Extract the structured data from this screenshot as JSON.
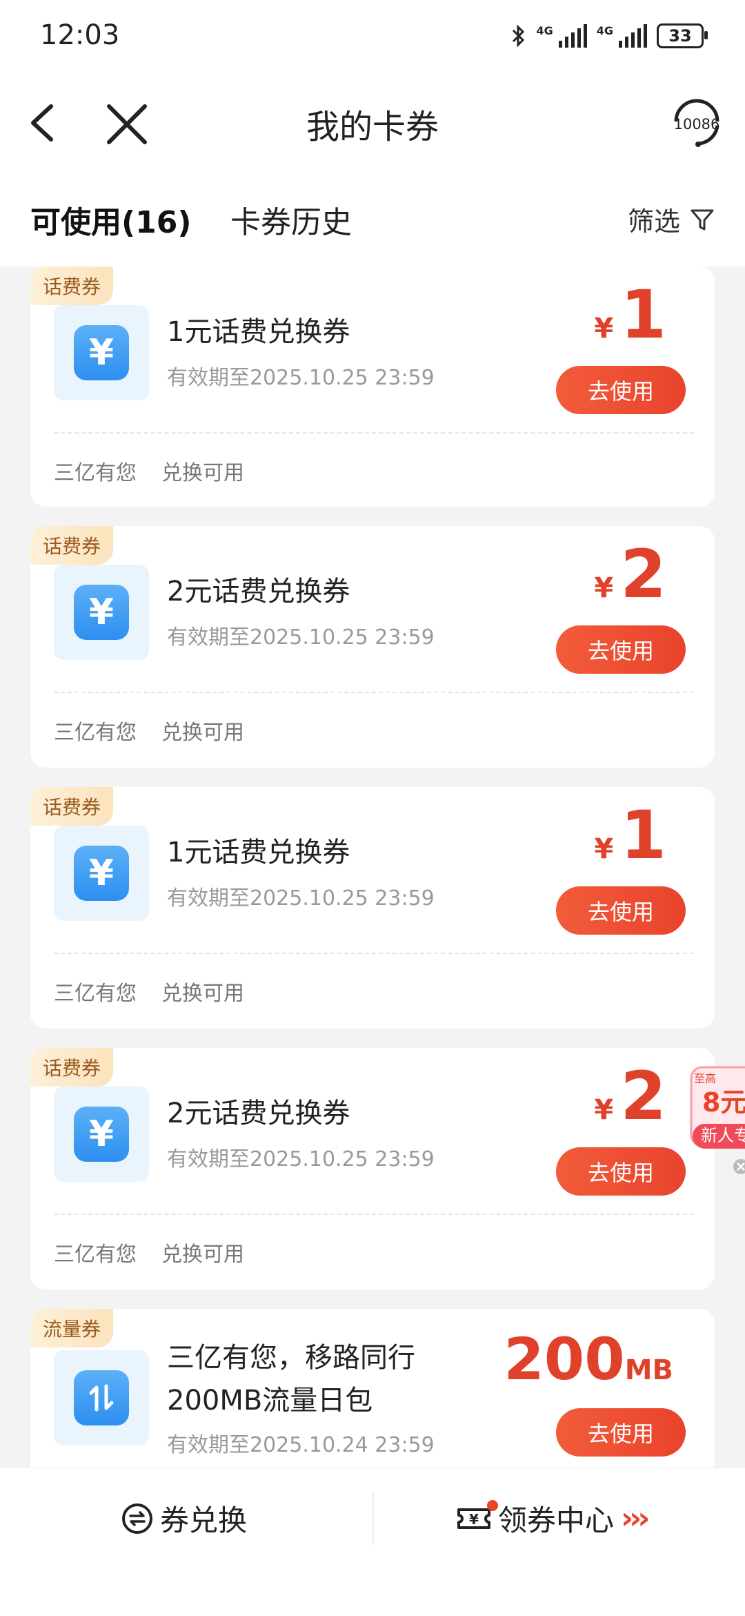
{
  "status_bar": {
    "time": "12:03",
    "network_1": "4G",
    "network_2": "4G",
    "battery": "33"
  },
  "nav": {
    "title": "我的卡券",
    "service_number": "10086"
  },
  "tabs": {
    "available": "可使用(16)",
    "history": "卡券历史",
    "filter": "筛选"
  },
  "coupons": [
    {
      "tag": "话费券",
      "icon": "yuan-icon",
      "title": "1元话费兑换券",
      "validity": "有效期至2025.10.25 23:59",
      "currency": "¥",
      "amount": "1",
      "button": "去使用",
      "source": "三亿有您",
      "note": "兑换可用"
    },
    {
      "tag": "话费券",
      "icon": "yuan-icon",
      "title": "2元话费兑换券",
      "validity": "有效期至2025.10.25 23:59",
      "currency": "¥",
      "amount": "2",
      "button": "去使用",
      "source": "三亿有您",
      "note": "兑换可用"
    },
    {
      "tag": "话费券",
      "icon": "yuan-icon",
      "title": "1元话费兑换券",
      "validity": "有效期至2025.10.25 23:59",
      "currency": "¥",
      "amount": "1",
      "button": "去使用",
      "source": "三亿有您",
      "note": "兑换可用"
    },
    {
      "tag": "话费券",
      "icon": "yuan-icon",
      "title": "2元话费兑换券",
      "validity": "有效期至2025.10.25 23:59",
      "currency": "¥",
      "amount": "2",
      "button": "去使用",
      "source": "三亿有您",
      "note": "兑换可用"
    },
    {
      "tag": "流量券",
      "icon": "data-transfer-icon",
      "title_line1": "三亿有您，移路同行",
      "title_line2": "200MB流量日包",
      "validity": "有效期至2025.10.24 23:59",
      "amount": "200",
      "unit": "MB",
      "button": "去使用"
    }
  ],
  "promo": {
    "top": "至高",
    "amount": "8元",
    "bottom": "新人专"
  },
  "bottom_bar": {
    "exchange": "券兑换",
    "center": "领券中心"
  }
}
